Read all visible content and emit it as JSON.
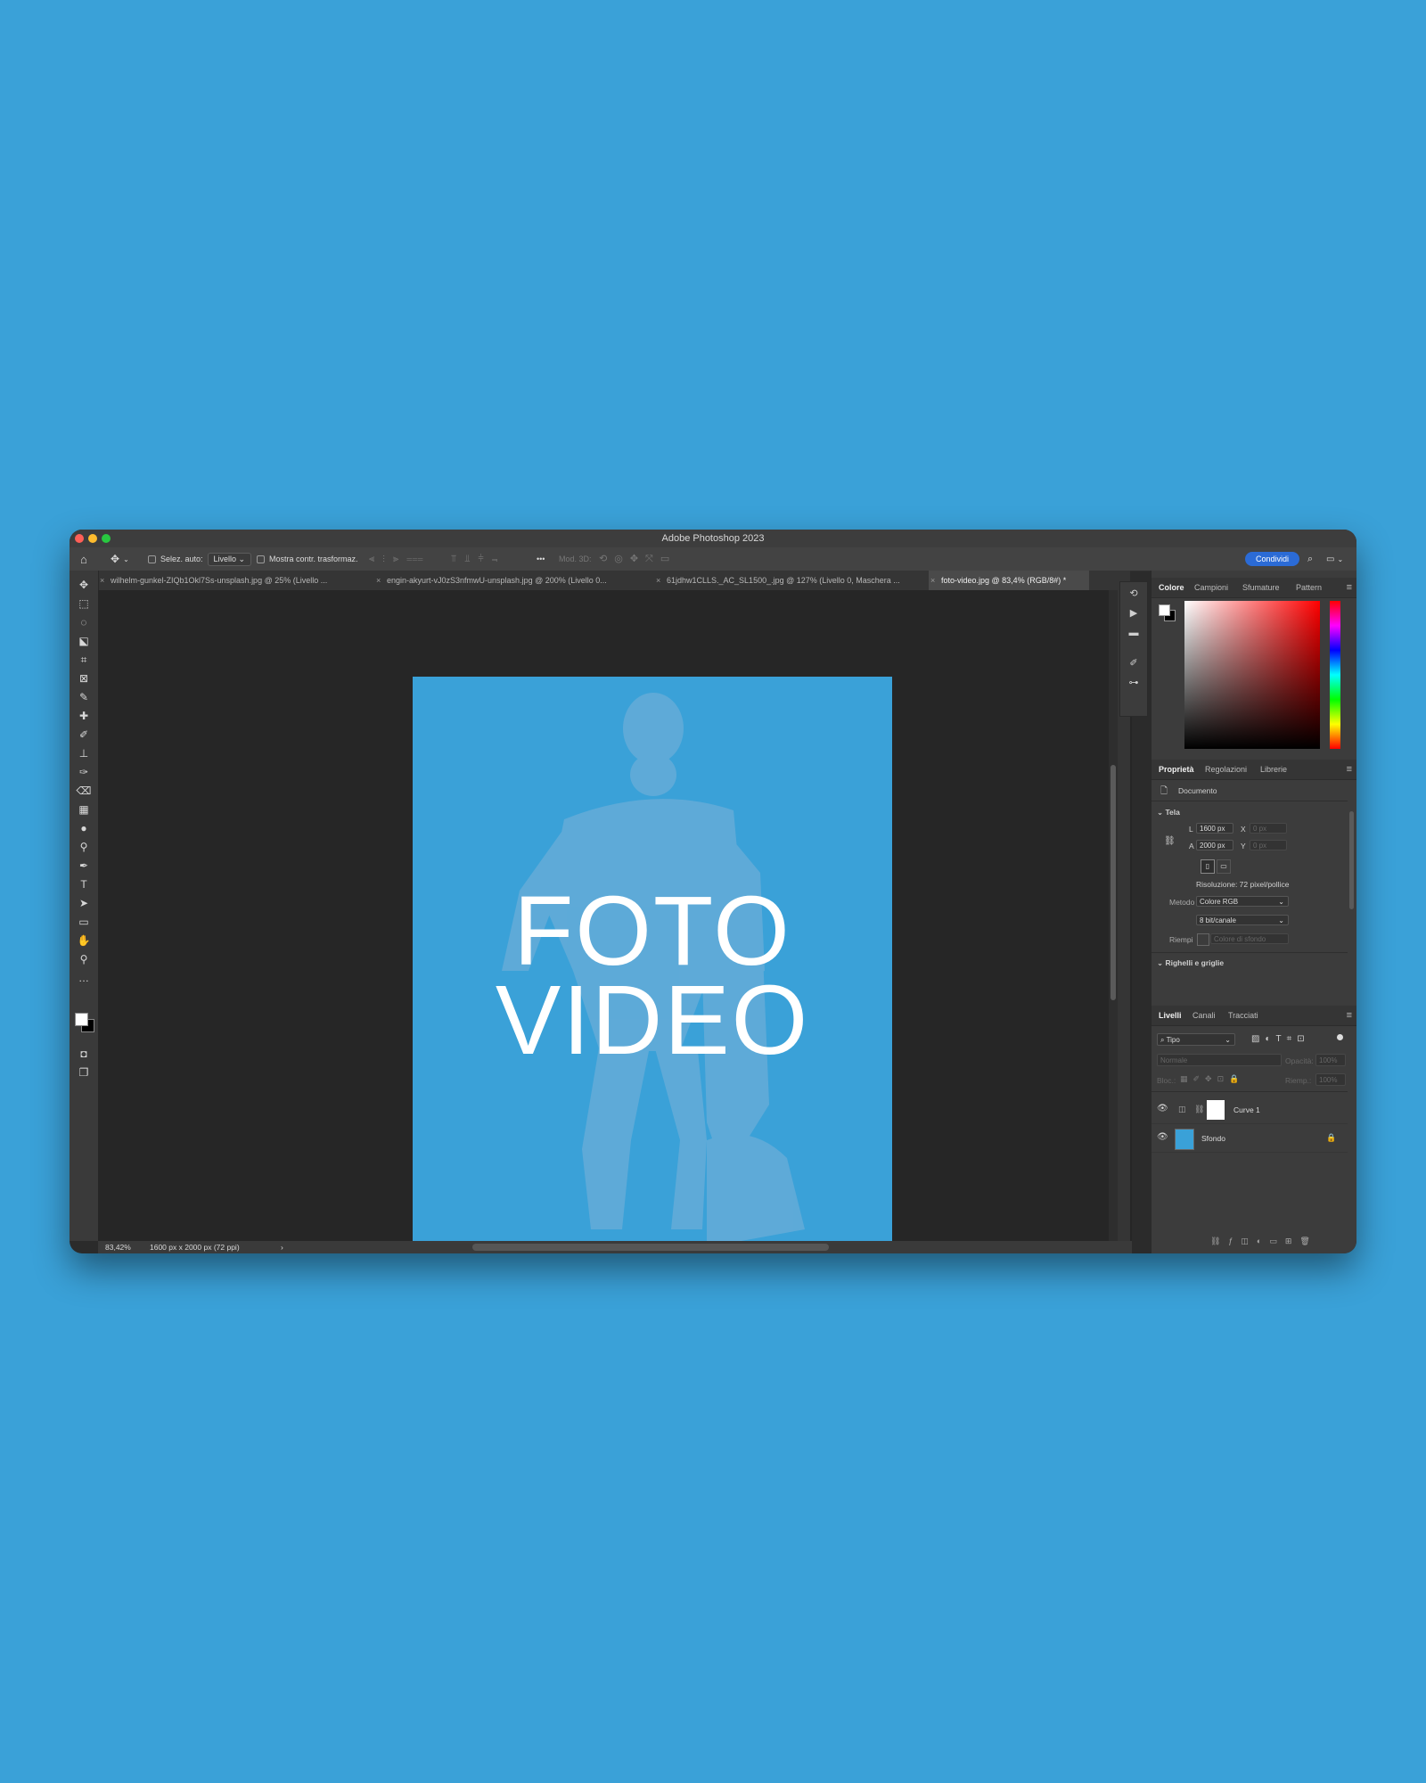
{
  "app": {
    "title": "Adobe Photoshop 2023"
  },
  "options_bar": {
    "auto_select_label": "Selez. auto:",
    "auto_select_value": "Livello",
    "show_transform_label": "Mostra contr. trasformaz.",
    "more": "•••",
    "mode3d_label": "Mod. 3D:",
    "share_label": "Condividi"
  },
  "doc_tabs": [
    {
      "label": "wilhelm-gunkel-ZIQb1Okl7Ss-unsplash.jpg @ 25% (Livello ...",
      "active": false
    },
    {
      "label": "engin-akyurt-vJ0zS3nfmwU-unsplash.jpg @ 200% (Livello 0...",
      "active": false
    },
    {
      "label": "61jdhw1CLLS._AC_SL1500_.jpg @ 127% (Livello 0, Maschera ...",
      "active": false
    },
    {
      "label": "foto-video.jpg @ 83,4% (RGB/8#) *",
      "active": true
    }
  ],
  "document": {
    "line1": "FOTO",
    "line2": "VIDEO",
    "background": "#3aa1d8"
  },
  "status_bar": {
    "zoom": "83,42%",
    "info": "1600 px x 2000 px (72 ppi)",
    "arrow": "›"
  },
  "color_panel": {
    "tabs": [
      "Colore",
      "Campioni",
      "Sfumature",
      "Pattern"
    ],
    "hue": "#ff0000"
  },
  "properties_panel": {
    "tabs": [
      "Proprietà",
      "Regolazioni",
      "Librerie"
    ],
    "doc_label": "Documento",
    "section_canvas": "Tela",
    "width_label": "L",
    "width_value": "1600 px",
    "x_label": "X",
    "x_value": "0 px",
    "height_label": "A",
    "height_value": "2000 px",
    "y_label": "Y",
    "y_value": "0 px",
    "resolution": "Risoluzione: 72 pixel/pollice",
    "mode_label": "Metodo",
    "mode_value": "Colore RGB",
    "depth_value": "8 bit/canale",
    "fill_label": "Riempi",
    "fill_value": "Colore di sfondo",
    "section_rulers": "Righelli e griglie"
  },
  "layers_panel": {
    "tabs": [
      "Livelli",
      "Canali",
      "Tracciati"
    ],
    "filter_value": "Tipo",
    "blend_mode": "Normale",
    "opacity_label": "Opacità:",
    "opacity_value": "100%",
    "lock_label": "Bloc.:",
    "fill_label": "Riemp.:",
    "fill_value": "100%",
    "layers": [
      {
        "name": "Curve 1",
        "type": "adjustment"
      },
      {
        "name": "Sfondo",
        "type": "background"
      }
    ]
  },
  "colors": {
    "accent": "#2b6bd6",
    "page_bg": "#3aa1d8"
  }
}
